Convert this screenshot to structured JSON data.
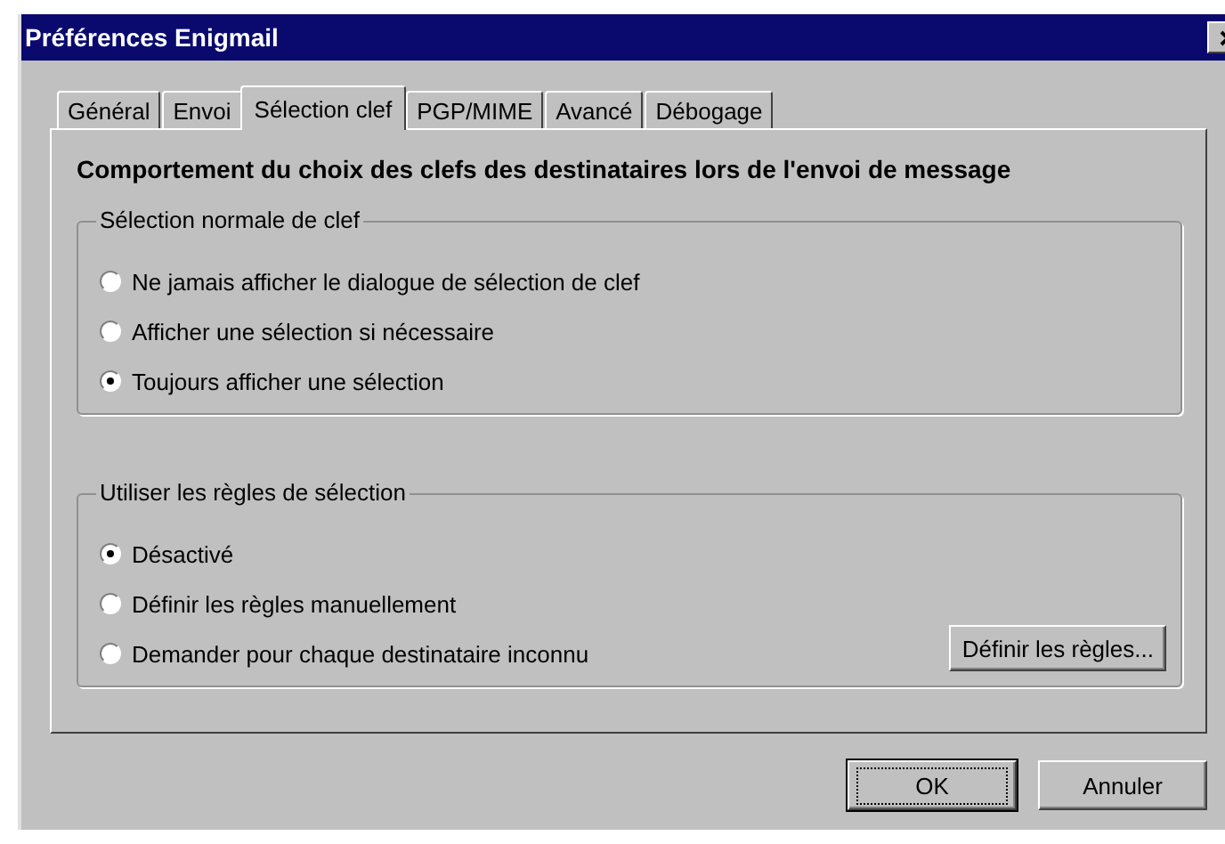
{
  "window": {
    "title": "Préférences Enigmail"
  },
  "tabs": [
    {
      "label": "Général",
      "selected": false
    },
    {
      "label": "Envoi",
      "selected": false
    },
    {
      "label": "Sélection clef",
      "selected": true
    },
    {
      "label": "PGP/MIME",
      "selected": false
    },
    {
      "label": "Avancé",
      "selected": false
    },
    {
      "label": "Débogage",
      "selected": false
    }
  ],
  "heading": "Comportement du choix des clefs des destinataires lors de l'envoi de message",
  "groups": [
    {
      "title": "Sélection normale de clef",
      "options": [
        {
          "label": "Ne jamais afficher le dialogue de sélection de clef",
          "selected": false
        },
        {
          "label": "Afficher une sélection si nécessaire",
          "selected": false
        },
        {
          "label": "Toujours afficher une sélection",
          "selected": true
        }
      ]
    },
    {
      "title": "Utiliser les règles de sélection",
      "options": [
        {
          "label": "Désactivé",
          "selected": true
        },
        {
          "label": "Définir les règles manuellement",
          "selected": false
        },
        {
          "label": "Demander pour chaque destinataire inconnu",
          "selected": false
        }
      ],
      "button": "Définir les règles..."
    }
  ],
  "buttons": [
    {
      "label": "OK",
      "default": true
    },
    {
      "label": "Annuler",
      "default": false
    }
  ]
}
